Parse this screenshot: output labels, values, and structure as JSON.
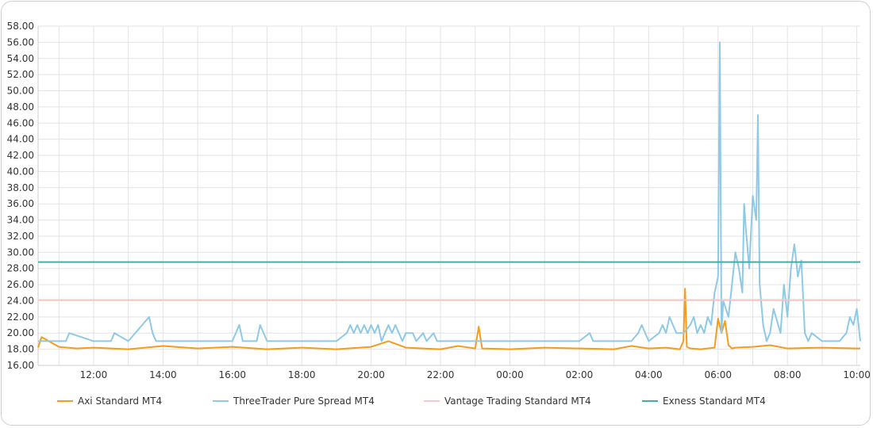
{
  "chart_data": {
    "type": "line",
    "title": "",
    "xlabel": "",
    "ylabel": "",
    "ylim": [
      16,
      58
    ],
    "y_ticks": [
      "16.00",
      "18.00",
      "20.00",
      "22.00",
      "24.00",
      "26.00",
      "28.00",
      "30.00",
      "32.00",
      "34.00",
      "36.00",
      "38.00",
      "40.00",
      "42.00",
      "44.00",
      "46.00",
      "48.00",
      "50.00",
      "52.00",
      "54.00",
      "56.00",
      "58.00"
    ],
    "x_range_hours": [
      10.4,
      34.1
    ],
    "x_ticks": [
      "12:00",
      "14:00",
      "16:00",
      "18:00",
      "20:00",
      "22:00",
      "00:00",
      "02:00",
      "04:00",
      "06:00",
      "08:00",
      "10:00"
    ],
    "grid": true,
    "legend_position": "bottom",
    "series": [
      {
        "name": "Axi Standard MT4",
        "color": "#f39c1f",
        "x": [
          10.4,
          10.5,
          11,
          11.5,
          12,
          13,
          14,
          15,
          16,
          17,
          18,
          19,
          20,
          20.5,
          21,
          22,
          22.5,
          23,
          23.1,
          23.2,
          24,
          25,
          26,
          27,
          27.5,
          28,
          28.5,
          28.9,
          29,
          29.05,
          29.1,
          29.2,
          29.5,
          29.9,
          30,
          30.1,
          30.2,
          30.3,
          30.4,
          30.5,
          31,
          31.5,
          32,
          33,
          34,
          34.1
        ],
        "y": [
          18.2,
          19.5,
          18.3,
          18.1,
          18.2,
          18.0,
          18.4,
          18.1,
          18.3,
          18.0,
          18.2,
          18.0,
          18.3,
          19.0,
          18.2,
          18.0,
          18.4,
          18.1,
          20.8,
          18.1,
          18.0,
          18.2,
          18.1,
          18.0,
          18.4,
          18.1,
          18.2,
          18.0,
          19.0,
          25.5,
          18.3,
          18.1,
          18.0,
          18.2,
          21.8,
          20.0,
          21.5,
          18.5,
          18.1,
          18.2,
          18.3,
          18.5,
          18.1,
          18.2,
          18.1,
          18.1
        ]
      },
      {
        "name": "ThreeTrader Pure Spread MT4",
        "color": "#8ec9e6",
        "x": [
          10.4,
          11,
          11.2,
          11.3,
          12,
          12.5,
          12.6,
          13,
          13.6,
          13.7,
          13.8,
          13.9,
          14,
          15,
          16,
          16.2,
          16.3,
          16.7,
          16.8,
          17,
          19,
          19.3,
          19.4,
          19.5,
          19.6,
          19.7,
          19.8,
          19.9,
          20,
          20.1,
          20.2,
          20.3,
          20.4,
          20.5,
          20.6,
          20.7,
          20.8,
          20.9,
          21,
          21.2,
          21.3,
          21.5,
          21.6,
          21.8,
          21.9,
          22,
          22.5,
          23,
          23.5,
          24,
          25,
          26,
          26.3,
          26.4,
          27,
          27.5,
          27.7,
          27.8,
          28,
          28.3,
          28.4,
          28.5,
          28.6,
          28.7,
          28.8,
          29,
          29.2,
          29.3,
          29.4,
          29.5,
          29.6,
          29.7,
          29.8,
          29.9,
          30,
          30.05,
          30.1,
          30.15,
          30.3,
          30.4,
          30.5,
          30.6,
          30.7,
          30.75,
          30.8,
          30.9,
          31,
          31.1,
          31.15,
          31.2,
          31.3,
          31.4,
          31.5,
          31.6,
          31.8,
          31.9,
          32,
          32.1,
          32.2,
          32.3,
          32.4,
          32.5,
          32.6,
          32.7,
          33,
          33.5,
          33.7,
          33.8,
          33.9,
          34,
          34.1
        ],
        "y": [
          19,
          19,
          19,
          20,
          19,
          19,
          20,
          19,
          22,
          20,
          19,
          19,
          19,
          19,
          19,
          21,
          19,
          19,
          21,
          19,
          19,
          20,
          21,
          20,
          21,
          20,
          21,
          20,
          21,
          20,
          21,
          19,
          20,
          21,
          20,
          21,
          20,
          19,
          20,
          20,
          19,
          20,
          19,
          20,
          19,
          19,
          19,
          19,
          19,
          19,
          19,
          19,
          20,
          19,
          19,
          19,
          20,
          21,
          19,
          20,
          21,
          20,
          22,
          21,
          20,
          20,
          21,
          22,
          20,
          21,
          20,
          22,
          21,
          25,
          27,
          56,
          20,
          24,
          22,
          26,
          30,
          28,
          25,
          36,
          33,
          28,
          37,
          34,
          47,
          26,
          21,
          19,
          20,
          23,
          20,
          26,
          22,
          28,
          31,
          27,
          29,
          20,
          19,
          20,
          19,
          19,
          20,
          22,
          21,
          23,
          19
        ],
        "y_note": ""
      },
      {
        "name": "Vantage Trading Standard MT4",
        "color": "#f6c7c4",
        "x": [
          10.4,
          34.1
        ],
        "y": [
          24.1,
          24.1
        ]
      },
      {
        "name": "Exness Standard MT4",
        "color": "#3fb0a6",
        "x": [
          10.4,
          34.1
        ],
        "y": [
          28.8,
          28.8
        ]
      }
    ]
  }
}
